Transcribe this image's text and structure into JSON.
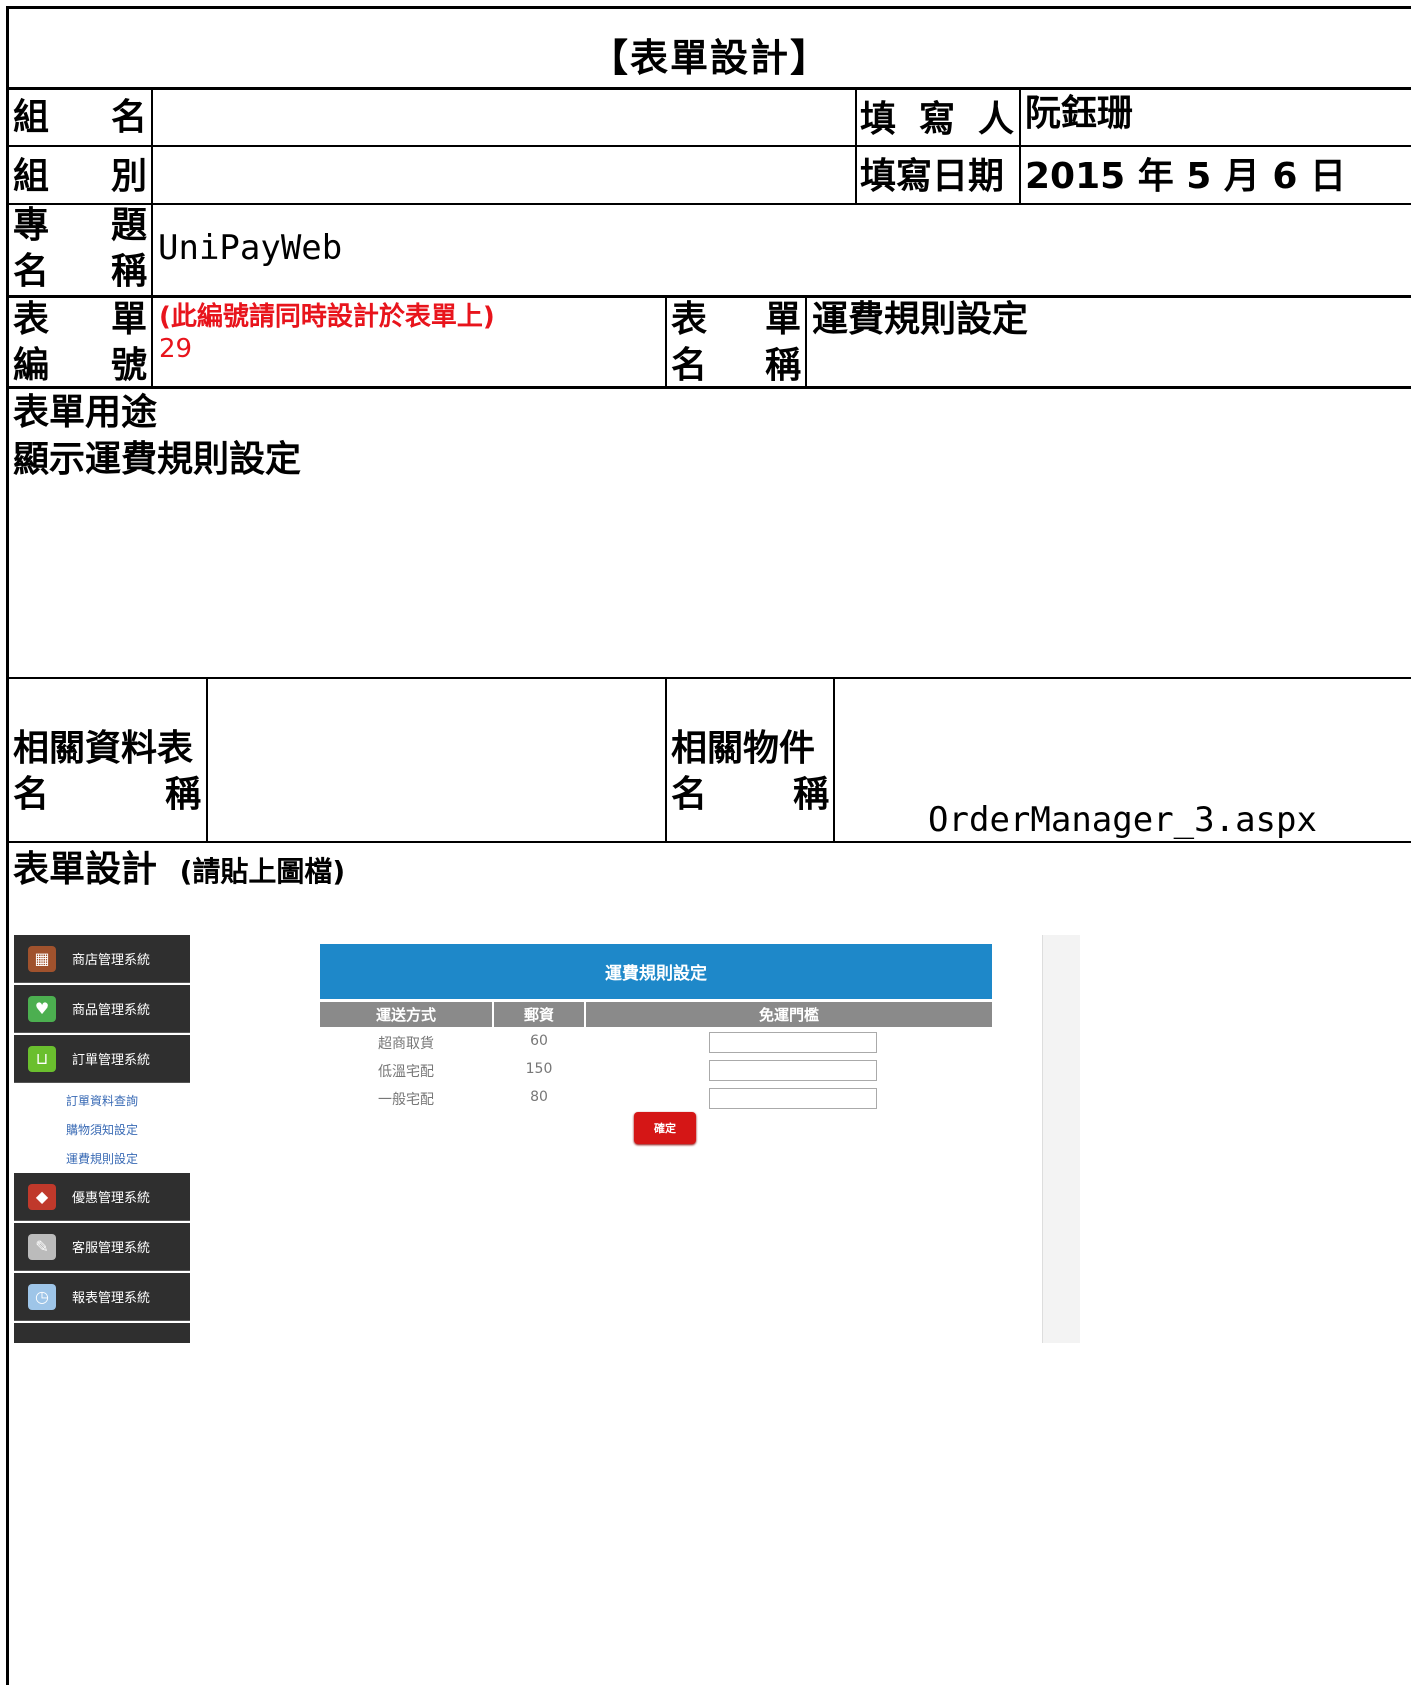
{
  "form": {
    "title": "【表單設計】",
    "group_name_label": [
      "組",
      "名"
    ],
    "group_name_value": "",
    "filler_label": [
      "填",
      "寫",
      "人"
    ],
    "filler_value": "阮鈺珊",
    "group_label": [
      "組",
      "別"
    ],
    "group_value": "",
    "fill_date_label": "填寫日期",
    "fill_date_value": "2015 年 5 月 6 日",
    "project_label": [
      [
        "專",
        "題"
      ],
      [
        "名",
        "稱"
      ]
    ],
    "project_value": "UniPayWeb",
    "form_no_label": [
      [
        "表",
        "單"
      ],
      [
        "編",
        "號"
      ]
    ],
    "form_no_note": "(此編號請同時設計於表單上)",
    "form_no_value": "29",
    "form_name_label": [
      [
        "表",
        "單"
      ],
      [
        "名",
        "稱"
      ]
    ],
    "form_name_value": "運費規則設定",
    "purpose_label": "表單用途",
    "purpose_value": "顯示運費規則設定",
    "related_table_label": [
      "相關資料表",
      [
        "名",
        "稱"
      ]
    ],
    "related_table_value": "",
    "related_object_label": [
      "相關物件",
      [
        "名",
        "稱"
      ]
    ],
    "related_object_value": "OrderManager_3.aspx",
    "design_label": "表單設計",
    "design_note": "(請貼上圖檔)"
  },
  "screenshot": {
    "sidebar": [
      {
        "label": "商店管理系統",
        "icon": "store-icon",
        "color": "#a0522d"
      },
      {
        "label": "商品管理系統",
        "icon": "shopping-bag-icon",
        "color": "#4caf50"
      },
      {
        "label": "訂單管理系統",
        "icon": "basket-icon",
        "color": "#6abf2e"
      },
      {
        "label": "優惠管理系統",
        "icon": "tag-icon",
        "color": "#c0392b"
      },
      {
        "label": "客服管理系統",
        "icon": "note-icon",
        "color": "#bbbbbb"
      },
      {
        "label": "報表管理系統",
        "icon": "report-icon",
        "color": "#9ec5e8"
      }
    ],
    "submenu": [
      "訂單資料查詢",
      "購物須知設定",
      "運費規則設定"
    ],
    "banner": "運費規則設定",
    "columns": [
      "運送方式",
      "郵資",
      "免運門檻"
    ],
    "rows": [
      {
        "method": "超商取貨",
        "fee": "60",
        "threshold": ""
      },
      {
        "method": "低溫宅配",
        "fee": "150",
        "threshold": ""
      },
      {
        "method": "一般宅配",
        "fee": "80",
        "threshold": ""
      }
    ],
    "confirm_button": "確定",
    "accent_color": "#1e88c9",
    "button_color": "#d51616"
  }
}
